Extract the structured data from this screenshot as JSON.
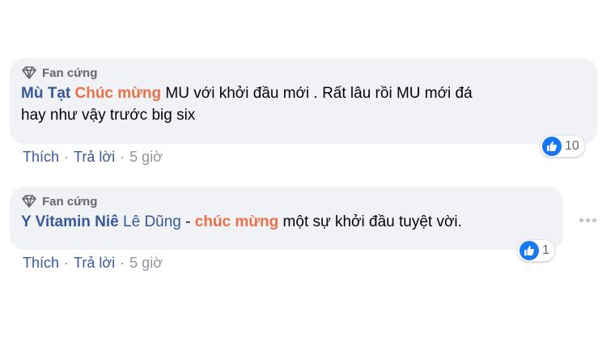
{
  "comments": [
    {
      "badge": "Fan cứng",
      "author": "Mù Tạt",
      "highlight": "Chúc mừng",
      "text_line1": " MU với khởi đầu mới . Rất lâu rồi MU mới đá",
      "text_line2": "hay như vậy trước big six",
      "reaction_count": "10",
      "actions": {
        "like": "Thích",
        "reply": "Trả lời",
        "time": "5 giờ",
        "separator": "·"
      }
    },
    {
      "badge": "Fan cứng",
      "author": "Y Vitamin Niê",
      "mention": "Lê Dũng",
      "dash": " - ",
      "highlight": "chúc mừng",
      "text": " một sự khởi đầu tuyệt vời.",
      "reaction_count": "1",
      "actions": {
        "like": "Thích",
        "reply": "Trả lời",
        "time": "5 giờ",
        "separator": "·"
      }
    }
  ],
  "icons": {
    "badge": "diamond-icon",
    "reaction": "like-thumb-icon",
    "more": "more-options-icon"
  },
  "colors": {
    "link": "#385898",
    "highlight": "#e9714a",
    "bubble": "#f0f2f5",
    "like": "#1877f2"
  }
}
